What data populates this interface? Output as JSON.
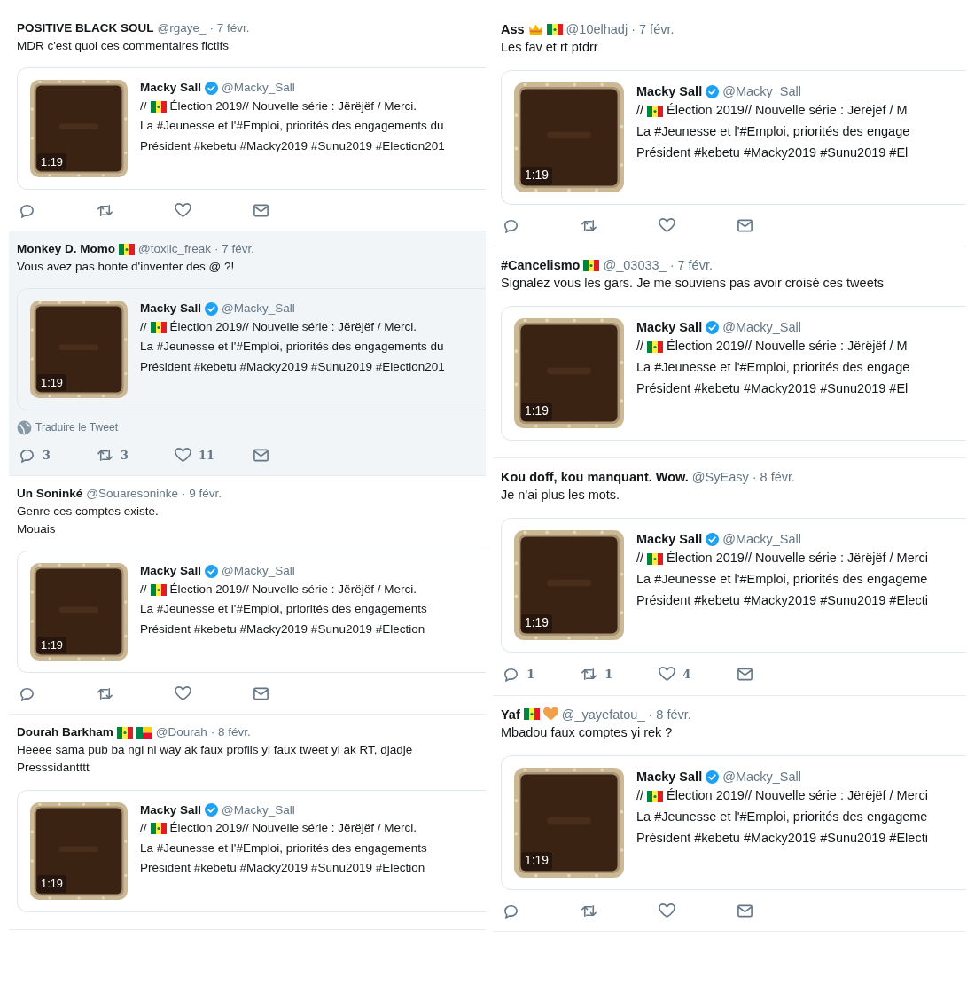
{
  "columns": [
    {
      "tweets": [
        {
          "name": "POSITIVE BLACK SOUL",
          "handle": "@rgaye_",
          "date": "· 7 févr.",
          "highlighted": false,
          "text_lines": [
            "MDR c'est quoi ces commentaires fictifs"
          ],
          "quote": {
            "name": "Macky Sall",
            "verified": true,
            "handle": "@Macky_Sall",
            "prefix": "//",
            "badge": {
              "kind": "flag-senegal"
            },
            "lines": [
              "Élection 2019// Nouvelle série : Jërëjëf / Merci.",
              "La #Jeunesse et l'#Emploi, priorités des engagements du",
              "Président #kebetu #Macky2019 #Sunu2019 #Election201"
            ],
            "duration": "1:19"
          },
          "actions": [
            {
              "kind": "reply"
            },
            {
              "kind": "retweet"
            },
            {
              "kind": "like"
            },
            {
              "kind": "message"
            }
          ]
        },
        {
          "name": "Monkey D. Momo",
          "badges": [
            {
              "kind": "flag-senegal"
            }
          ],
          "handle": "@toxiic_freak",
          "date": "· 7 févr.",
          "highlighted": true,
          "text_lines": [
            "Vous avez pas honte d'inventer des @ ?!"
          ],
          "quote": {
            "name": "Macky Sall",
            "verified": true,
            "handle": "@Macky_Sall",
            "prefix": "//",
            "badge": {
              "kind": "flag-senegal"
            },
            "lines": [
              "Élection 2019// Nouvelle série : Jërëjëf / Merci.",
              "La #Jeunesse et l'#Emploi, priorités des engagements du",
              "Président #kebetu #Macky2019 #Sunu2019 #Election201"
            ],
            "duration": "1:19"
          },
          "translate": "Traduire le Tweet",
          "actions": [
            {
              "kind": "reply",
              "count": "3"
            },
            {
              "kind": "retweet",
              "count": "3"
            },
            {
              "kind": "like",
              "count": "11"
            },
            {
              "kind": "message"
            }
          ]
        },
        {
          "name": "Un Soninké",
          "handle": "@Souaresoninke",
          "date": "· 9 févr.",
          "highlighted": false,
          "text_lines": [
            "Genre ces comptes existe.",
            "Mouais"
          ],
          "quote": {
            "name": "Macky Sall",
            "verified": true,
            "handle": "@Macky_Sall",
            "prefix": "//",
            "badge": {
              "kind": "flag-senegal"
            },
            "lines": [
              "Élection 2019// Nouvelle série : Jërëjëf / Merci.",
              "La #Jeunesse et l'#Emploi, priorités des engagements",
              "Président #kebetu #Macky2019 #Sunu2019 #Election"
            ],
            "duration": "1:19"
          },
          "actions": [
            {
              "kind": "reply"
            },
            {
              "kind": "retweet"
            },
            {
              "kind": "like"
            },
            {
              "kind": "message"
            }
          ]
        },
        {
          "name": "Dourah Barkham",
          "badges": [
            {
              "kind": "flag-senegal"
            },
            {
              "kind": "flag-benin"
            }
          ],
          "handle": "@Dourah",
          "date": "· 8 févr.",
          "highlighted": false,
          "text_lines": [
            "Heeee sama pub ba ngi ni way ak faux profils yi faux tweet yi ak RT, djadje",
            "Presssidantttt"
          ],
          "quote": {
            "name": "Macky Sall",
            "verified": true,
            "handle": "@Macky_Sall",
            "prefix": "//",
            "badge": {
              "kind": "flag-senegal"
            },
            "lines": [
              "Élection 2019// Nouvelle série : Jërëjëf / Merci.",
              "La #Jeunesse et l'#Emploi, priorités des engagements",
              "Président #kebetu #Macky2019 #Sunu2019 #Election"
            ],
            "duration": "1:19"
          }
        }
      ]
    },
    {
      "tweets": [
        {
          "name": "Ass",
          "badges": [
            {
              "kind": "crown"
            },
            {
              "kind": "flag-senegal"
            }
          ],
          "handle": "@10elhadj",
          "date": "· 7 févr.",
          "highlighted": false,
          "text_lines": [
            "Les fav et rt ptdrr"
          ],
          "quote": {
            "name": "Macky Sall",
            "verified": true,
            "handle": "@Macky_Sall",
            "prefix": "//",
            "badge": {
              "kind": "flag-senegal"
            },
            "lines": [
              "Élection 2019// Nouvelle série : Jërëjëf / M",
              "La #Jeunesse et l'#Emploi, priorités des engage",
              "Président #kebetu #Macky2019 #Sunu2019 #El"
            ],
            "duration": "1:19"
          },
          "actions": [
            {
              "kind": "reply"
            },
            {
              "kind": "retweet"
            },
            {
              "kind": "like"
            },
            {
              "kind": "message"
            }
          ]
        },
        {
          "name": "#Cancelismo",
          "badges": [
            {
              "kind": "flag-senegal"
            }
          ],
          "handle": "@_03033_",
          "date": "· 7 févr.",
          "highlighted": false,
          "text_lines": [
            "Signalez vous les gars. Je me souviens pas avoir croisé ces tweets"
          ],
          "quote": {
            "name": "Macky Sall",
            "verified": true,
            "handle": "@Macky_Sall",
            "prefix": "//",
            "badge": {
              "kind": "flag-senegal"
            },
            "lines": [
              "Élection 2019// Nouvelle série : Jërëjëf / M",
              "La #Jeunesse et l'#Emploi, priorités des engage",
              "Président #kebetu #Macky2019 #Sunu2019 #El"
            ],
            "duration": "1:19"
          }
        },
        {
          "name": "Kou doff, kou manquant. Wow.",
          "handle": "@SyEasy",
          "date": "· 8 févr.",
          "highlighted": false,
          "text_lines": [
            "Je n'ai plus les mots."
          ],
          "quote": {
            "name": "Macky Sall",
            "verified": true,
            "handle": "@Macky_Sall",
            "prefix": "//",
            "badge": {
              "kind": "flag-senegal"
            },
            "lines": [
              "Élection 2019// Nouvelle série : Jërëjëf / Merci",
              "La #Jeunesse et l'#Emploi, priorités des engageme",
              "Président #kebetu #Macky2019 #Sunu2019 #Electi"
            ],
            "duration": "1:19"
          },
          "actions": [
            {
              "kind": "reply",
              "count": "1"
            },
            {
              "kind": "retweet",
              "count": "1"
            },
            {
              "kind": "like",
              "count": "4"
            },
            {
              "kind": "message"
            }
          ]
        },
        {
          "name": "Yaf",
          "badges": [
            {
              "kind": "flag-senegal"
            },
            {
              "kind": "heart"
            }
          ],
          "handle": "@_yayefatou_",
          "date": "· 8 févr.",
          "highlighted": false,
          "text_lines": [
            "Mbadou faux comptes yi rek ?"
          ],
          "quote": {
            "name": "Macky Sall",
            "verified": true,
            "handle": "@Macky_Sall",
            "prefix": "//",
            "badge": {
              "kind": "flag-senegal"
            },
            "lines": [
              "Élection 2019// Nouvelle série : Jërëjëf / Merci",
              "La #Jeunesse et l'#Emploi, priorités des engageme",
              "Président #kebetu #Macky2019 #Sunu2019 #Electi"
            ],
            "duration": "1:19"
          },
          "actions": [
            {
              "kind": "reply"
            },
            {
              "kind": "retweet"
            },
            {
              "kind": "like"
            },
            {
              "kind": "message"
            }
          ]
        }
      ]
    }
  ]
}
